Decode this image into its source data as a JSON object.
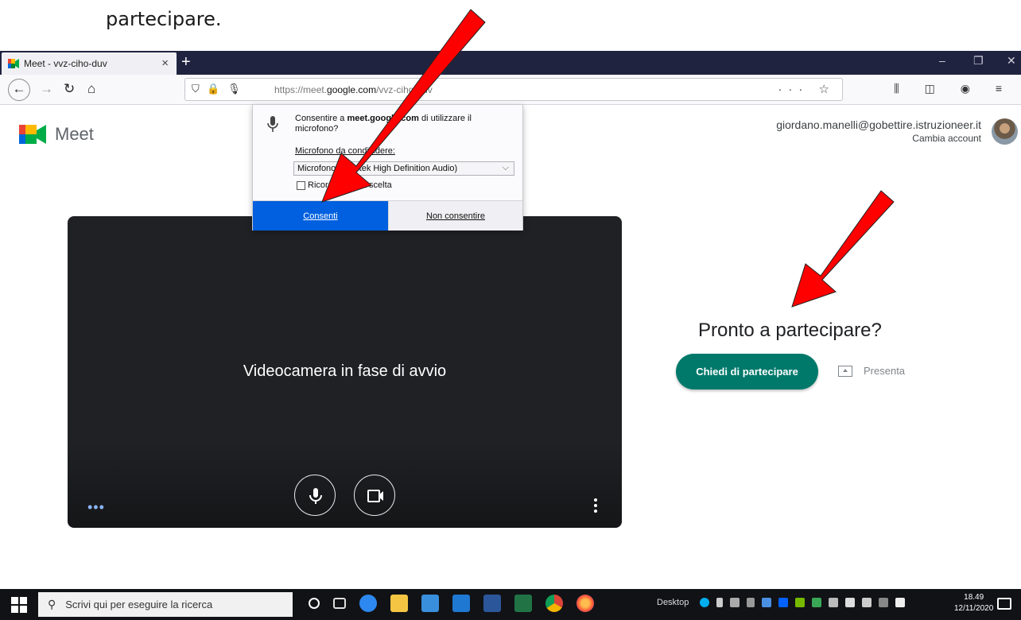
{
  "doc": {
    "caption": "partecipare."
  },
  "browser": {
    "tab_title": "Meet - vvz-ciho-duv",
    "tab_close": "×",
    "new_tab": "+",
    "win_min": "–",
    "win_restore": "❐",
    "win_close": "✕",
    "url_scheme": "https://meet.",
    "url_host": "google.com",
    "url_path": "/vvz-ciho-duv",
    "url_icons": "⛉ 🔒 🎙",
    "url_right": "··· ☆",
    "toolbar_right": "⫼ ◫ ◉ ≡"
  },
  "popup": {
    "text_prefix": "Consentire a ",
    "text_host": "meet.google.com",
    "text_suffix": " di utilizzare il microfono?",
    "label": "Microfono da condividere:",
    "selected_device": "Microfono (Realtek High Definition Audio)",
    "remember": "Ricorda questa scelta",
    "allow": "Consenti",
    "deny": "Non consentire"
  },
  "meet": {
    "logo_text": "Meet",
    "account_email": "giordano.manelli@gobettire.istruzioneer.it",
    "switch_account": "Cambia account",
    "preview_message": "Videocamera in fase di avvio",
    "dots_left": "•••",
    "ready_title": "Pronto a partecipare?",
    "join_button": "Chiedi di partecipare",
    "present_button": "Presenta"
  },
  "taskbar": {
    "search_placeholder": "Scrivi qui per eseguire la ricerca",
    "desktop": "Desktop",
    "time": "18.49",
    "date": "12/11/2020"
  },
  "colors": {
    "meet_green": "#00796b",
    "firefox_blue": "#0060df",
    "arrow_red": "#ff0000"
  }
}
